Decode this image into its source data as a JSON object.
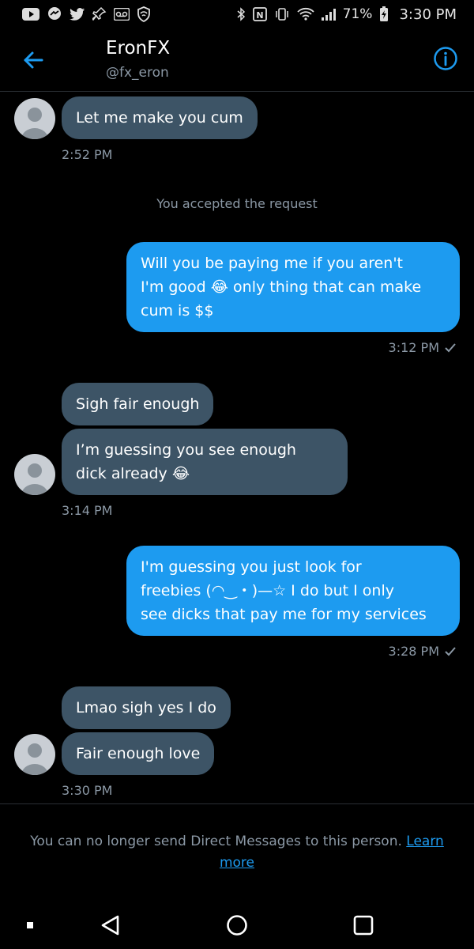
{
  "status_bar": {
    "battery": "71%",
    "time": "3:30 PM"
  },
  "header": {
    "title": "EronFX",
    "handle": "@fx_eron"
  },
  "messages": [
    {
      "text": "Let me make you cum",
      "time": "2:52 PM"
    },
    {
      "system": "You accepted the request"
    },
    {
      "text_lines": [
        "Will you be paying me if you aren't",
        "I'm good 😂 only thing that can make",
        "cum is $$"
      ],
      "time": "3:12 PM"
    },
    {
      "text": "Sigh fair enough"
    },
    {
      "text_lines": [
        "I’m guessing you see enough",
        "dick already 😂"
      ],
      "time": "3:14 PM"
    },
    {
      "text_lines": [
        "I'm guessing you just look for",
        "freebies (◠‿・)—☆ I do but I only",
        "see dicks that pay me for my services"
      ],
      "time": "3:28 PM"
    },
    {
      "text": "Lmao sigh yes I do"
    },
    {
      "text": "Fair enough love",
      "time": "3:30 PM"
    }
  ],
  "footer": {
    "notice": "You can no longer send Direct Messages to this person.",
    "link": "Learn more"
  },
  "icons": [
    "back-arrow-icon",
    "info-icon",
    "nav-recents-icon",
    "nav-back-icon",
    "nav-home-icon",
    "nav-overview-icon"
  ],
  "colors": {
    "accent": "#1d9bf0",
    "incoming_bubble": "#3d5466",
    "muted_text": "#8b98a5",
    "background": "#000000"
  }
}
